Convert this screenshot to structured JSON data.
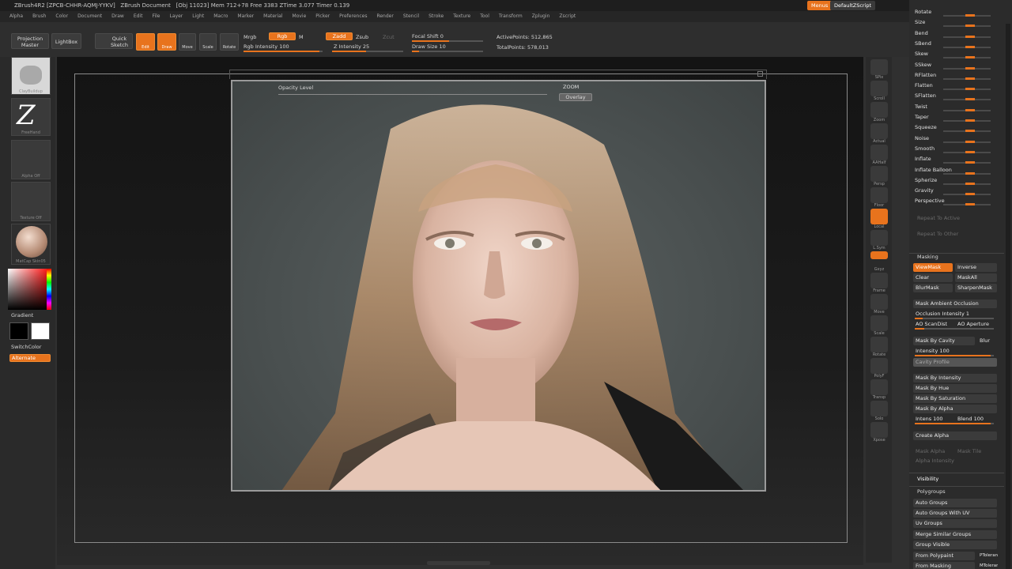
{
  "titlebar": {
    "app": "ZBrush4R2",
    "session": "[ZPCB-CHHR-AQMJ-YYKV]",
    "doc": "ZBrush Document",
    "stats": "[Obj 11023] Mem 712+78 Free 3383 ZTime 3.077 Timer 0.139"
  },
  "topright": {
    "menus": "Menus",
    "script": "DefaultZScript"
  },
  "menu": [
    "Alpha",
    "Brush",
    "Color",
    "Document",
    "Draw",
    "Edit",
    "File",
    "Layer",
    "Light",
    "Macro",
    "Marker",
    "Material",
    "Movie",
    "Picker",
    "Preferences",
    "Render",
    "Stencil",
    "Stroke",
    "Texture",
    "Tool",
    "Transform",
    "Zplugin",
    "Zscript"
  ],
  "shelf": {
    "projection_master": "Projection Master",
    "lightbox": "LightBox",
    "quick_sketch": "Quick Sketch",
    "edit": "Edit",
    "draw": "Draw",
    "move": "Move",
    "scale": "Scale",
    "rotate": "Rotate",
    "mrgb": "Mrgb",
    "rgb": "Rgb",
    "m": "M",
    "rgb_intensity": "Rgb Intensity 100",
    "zadd": "Zadd",
    "zsub": "Zsub",
    "zcut": "Zcut",
    "z_intensity": "Z Intensity 25",
    "focal_shift": "Focal Shift 0",
    "draw_size": "Draw Size 10",
    "active_points": "ActivePoints: 512,865",
    "total_points": "TotalPoints: 578,013"
  },
  "left": {
    "brush": "ClayBuildup",
    "stroke": "FreeHand",
    "alpha": "Alpha Off",
    "texture": "Texture Off",
    "material": "MatCap Skin05",
    "gradient": "Gradient",
    "switch_color": "SwitchColor",
    "alternate": "Alternate"
  },
  "overlay": {
    "opacity": "Opacity Level",
    "zoom": "ZOOM",
    "overlay_btn": "Overlay"
  },
  "right_tray": [
    {
      "n": "spix",
      "l": "SPix"
    },
    {
      "n": "scroll",
      "l": "Scroll"
    },
    {
      "n": "zoom",
      "l": "Zoom"
    },
    {
      "n": "actual",
      "l": "Actual"
    },
    {
      "n": "aahalf",
      "l": "AAHalf"
    },
    {
      "n": "persp",
      "l": "Persp"
    },
    {
      "n": "floor",
      "l": "Floor"
    },
    {
      "n": "local",
      "l": "Local"
    },
    {
      "n": "lsym",
      "l": "L.Sym"
    },
    {
      "n": "xyz",
      "l": "Gxyz"
    },
    {
      "n": "frame",
      "l": "Frame"
    },
    {
      "n": "move",
      "l": "Move"
    },
    {
      "n": "scale",
      "l": "Scale"
    },
    {
      "n": "rotate",
      "l": "Rotate"
    },
    {
      "n": "polyf",
      "l": "PolyF"
    },
    {
      "n": "transp",
      "l": "Transp"
    },
    {
      "n": "solo",
      "l": "Solo"
    },
    {
      "n": "xpose",
      "l": "Xpose"
    }
  ],
  "deform": [
    {
      "l": "Rotate"
    },
    {
      "l": "Size"
    },
    {
      "l": "Bend"
    },
    {
      "l": "SBend"
    },
    {
      "l": "Skew"
    },
    {
      "l": "SSkew"
    },
    {
      "l": "RFlatten"
    },
    {
      "l": "Flatten"
    },
    {
      "l": "SFlatten"
    },
    {
      "l": "Twist"
    },
    {
      "l": "Taper"
    },
    {
      "l": "Squeeze"
    },
    {
      "l": "Noise"
    },
    {
      "l": "Smooth"
    },
    {
      "l": "Inflate"
    },
    {
      "l": "Inflate Balloon"
    },
    {
      "l": "Spherize"
    },
    {
      "l": "Gravity"
    },
    {
      "l": "Perspective"
    }
  ],
  "repeat": {
    "active": "Repeat To Active",
    "other": "Repeat To Other"
  },
  "masking": {
    "title": "Masking",
    "viewmask": "ViewMask",
    "inverse": "Inverse",
    "clear": "Clear",
    "maskall": "MaskAll",
    "blurmask": "BlurMask",
    "sharpenmask": "SharpenMask",
    "ambient": "Mask Ambient Occlusion",
    "occl_int": "Occlusion Intensity 1",
    "ao_scan": "AO ScanDist",
    "ao_aperture": "AO Aperture",
    "cavity": "Mask By Cavity",
    "blur": "Blur",
    "intensity": "Intensity 100",
    "cavity_profile": "Cavity Profile",
    "by_intensity": "Mask By Intensity",
    "by_hue": "Mask By Hue",
    "by_sat": "Mask By Saturation",
    "by_alpha": "Mask By Alpha",
    "intens": "Intens 100",
    "blend": "Blend 100",
    "create_alpha": "Create Alpha",
    "mask_alpha": "Mask Alpha",
    "mask_tile": "Mask Tile",
    "alpha_int": "Alpha Intensity"
  },
  "visibility": {
    "title": "Visibility"
  },
  "polygroups": {
    "title": "Polygroups",
    "auto": "Auto Groups",
    "auto_uv": "Auto Groups With UV",
    "uv": "Uv Groups",
    "merge": "Merge Similar Groups",
    "visible": "Group Visible",
    "from_polypaint": "From Polypaint",
    "ptol": "PTolerance",
    "from_masking": "From Masking",
    "mtol": "MTolerance"
  }
}
